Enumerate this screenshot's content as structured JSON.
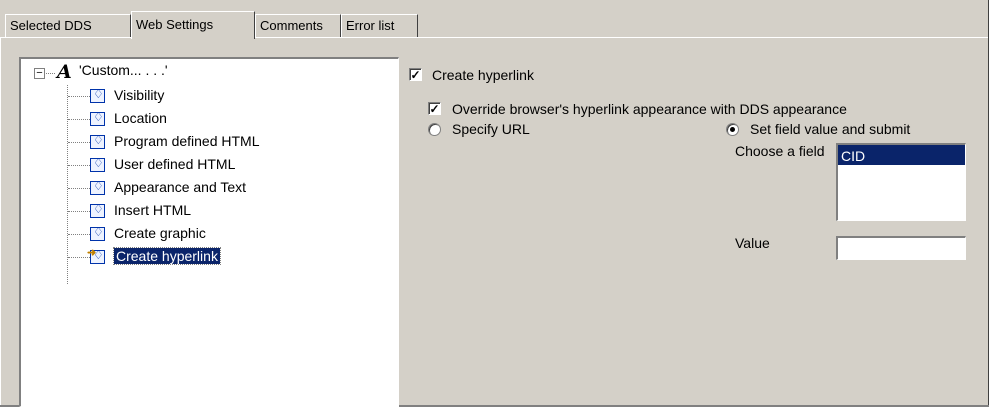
{
  "tabs": [
    {
      "label": "Selected DDS",
      "active": false
    },
    {
      "label": "Web Settings",
      "active": true
    },
    {
      "label": "Comments",
      "active": false
    },
    {
      "label": "Error list",
      "active": false
    }
  ],
  "tree": {
    "root": {
      "label": "'Custom... . . .'",
      "icon": "text-style-icon",
      "expander": "−"
    },
    "items": [
      {
        "label": "Visibility",
        "icon": "property-icon"
      },
      {
        "label": "Location",
        "icon": "property-icon"
      },
      {
        "label": "Program defined HTML",
        "icon": "property-icon"
      },
      {
        "label": "User defined HTML",
        "icon": "property-icon"
      },
      {
        "label": "Appearance and Text",
        "icon": "property-icon"
      },
      {
        "label": "Insert HTML",
        "icon": "property-icon"
      },
      {
        "label": "Create graphic",
        "icon": "property-icon"
      },
      {
        "label": "Create hyperlink",
        "icon": "property-arrow-icon",
        "selected": true
      }
    ]
  },
  "settings": {
    "create_hyperlink": {
      "label": "Create hyperlink",
      "checked": true
    },
    "override_appearance": {
      "label": "Override browser's hyperlink appearance with DDS appearance",
      "checked": true
    },
    "specify_url": {
      "label": "Specify URL",
      "selected": false
    },
    "set_field_value": {
      "label": "Set field value and submit",
      "selected": true
    },
    "choose_field_label": "Choose a field",
    "field_options": [
      {
        "label": "CID",
        "selected": true
      }
    ],
    "value_label": "Value",
    "value_text": ""
  },
  "colors": {
    "face": "#d4d0c8",
    "selection": "#0a246a",
    "icon_border": "#0033aa"
  }
}
